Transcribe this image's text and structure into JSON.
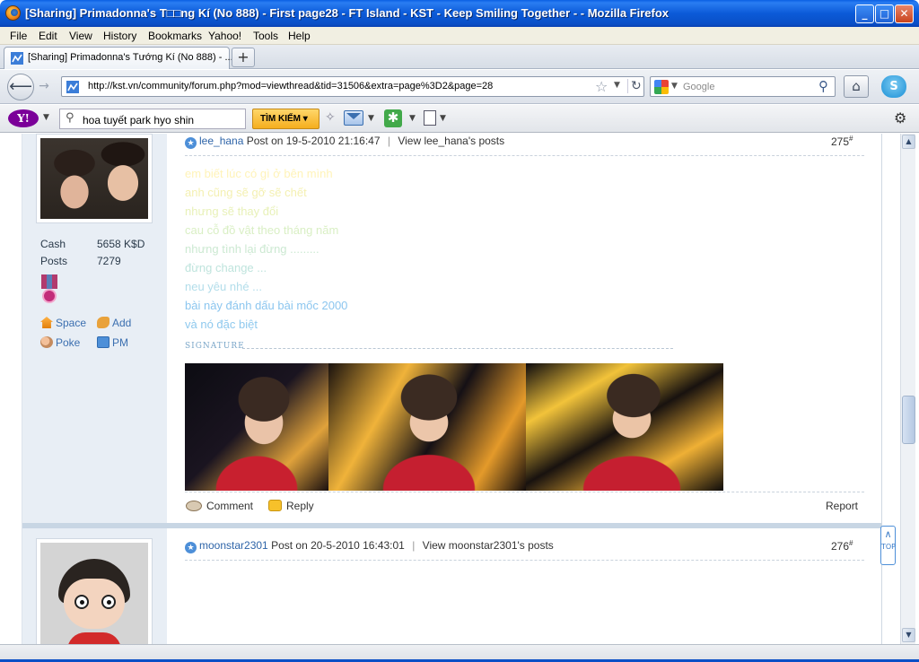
{
  "window": {
    "title": "[Sharing] Primadonna's T□□ng Kí (No 888) - First page28 - FT Island - KST - Keep Smiling Together - - Mozilla Firefox",
    "min_label": "_",
    "max_label": "□",
    "close_label": "✕"
  },
  "menu": [
    "File",
    "Edit",
    "View",
    "History",
    "Bookmarks",
    "Yahoo!",
    "Tools",
    "Help"
  ],
  "tab": {
    "title": "[Sharing] Primadonna's Tướng Kí (No 888) - ...",
    "newtab_label": "+"
  },
  "nav": {
    "back_label": "⟵",
    "forward_label": "→",
    "url": "http://kst.vn/community/forum.php?mod=viewthread&tid=31506&extra=page%3D2&page=28",
    "search_placeholder": "Google",
    "home_label": "⌂"
  },
  "yahoo": {
    "logo": "Y!",
    "query": "hoa tuyết park hyo shin",
    "search_button": "TÌM KIẾM"
  },
  "post1": {
    "username": "lee_hana",
    "posted": "Post on 19-5-2010 21:16:47",
    "view_posts": "View lee_hana's posts",
    "number": "275",
    "stats": [
      {
        "label": "Cash",
        "value": "5658 K$D"
      },
      {
        "label": "Posts",
        "value": "7279"
      }
    ],
    "actions": {
      "space": "Space",
      "add": "Add",
      "poke": "Poke",
      "pm": "PM"
    },
    "message_lines": [
      {
        "text": "em biết lúc có gì ở bên mình",
        "color": "#fff3b8"
      },
      {
        "text": "anh cũng sẽ gỡ sẽ chết",
        "color": "#f4f0b2"
      },
      {
        "text": "nhưng sẽ thay đổi",
        "color": "#e8f1b8"
      },
      {
        "text": "cau cỗ đồ vật theo tháng năm",
        "color": "#d9efc4"
      },
      {
        "text": "nhưng tình lại đừng .........",
        "color": "#cce9d2"
      },
      {
        "text": "đừng change ...",
        "color": "#bfe4dd"
      },
      {
        "text": "neu yêu nhé ...",
        "color": "#b2ddea"
      },
      {
        "text": "bài này đánh dấu bài mốc 2000",
        "color": "#8cc6ef"
      },
      {
        "text": "và nó đặc biệt",
        "color": "#8fc9ee"
      }
    ],
    "signature_label": "SIGNATURE",
    "comment_label": "Comment",
    "reply_label": "Reply",
    "report_label": "Report"
  },
  "post2": {
    "username": "moonstar2301",
    "posted": "Post on 20-5-2010 16:43:01",
    "view_posts": "View moonstar2301's posts",
    "number": "276"
  },
  "backtop_label": "TOP"
}
